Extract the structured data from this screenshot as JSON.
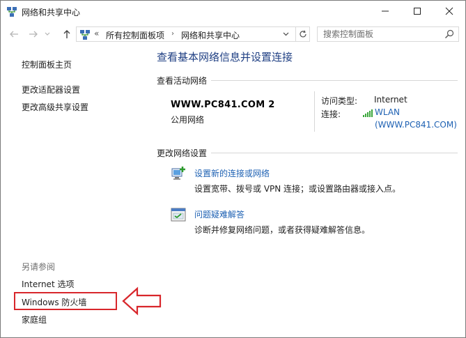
{
  "window": {
    "title": "网络和共享中心",
    "icons": {
      "app": "network-icon",
      "minimize": "minimize-icon",
      "maximize": "maximize-icon",
      "close": "close-icon"
    }
  },
  "nav": {
    "address": {
      "overflow": "«",
      "crumbs": [
        "所有控制面板项",
        "网络和共享中心"
      ],
      "separator": "›"
    },
    "search": {
      "placeholder": "搜索控制面板"
    }
  },
  "left_pane": {
    "home": "控制面板主页",
    "adapter_settings": "更改适配器设置",
    "advanced_sharing": "更改高级共享设置",
    "see_also": "另请参阅",
    "internet_options": "Internet 选项",
    "firewall": "Windows 防火墙",
    "homegroup": "家庭组"
  },
  "main": {
    "title": "查看基本网络信息并设置连接",
    "active_networks": {
      "heading": "查看活动网络",
      "network_name": "WWW.PC841.COM  2",
      "network_type": "公用网络",
      "access_type_label": "访问类型:",
      "access_type_value": "Internet",
      "connection_label": "连接:",
      "connection_line1": "WLAN",
      "connection_line2": "(WWW.PC841.COM)"
    },
    "change_settings": {
      "heading": "更改网络设置",
      "tasks": [
        {
          "icon": "new-connection-icon",
          "link": "设置新的连接或网络",
          "description": "设置宽带、拨号或 VPN 连接；或设置路由器或接入点。"
        },
        {
          "icon": "troubleshoot-icon",
          "link": "问题疑难解答",
          "description": "诊断并修复网络问题，或者获得疑难解答信息。"
        }
      ]
    }
  },
  "colors": {
    "link": "#1e61b3",
    "title": "#1f3f83",
    "annotation_red": "#d8262b"
  }
}
